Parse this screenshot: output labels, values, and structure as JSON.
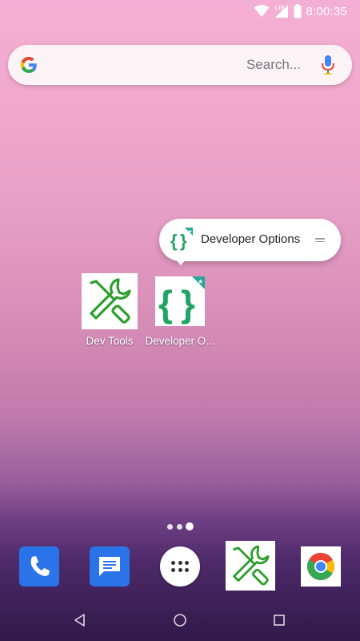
{
  "status_bar": {
    "time": "8:00:35",
    "network_label": "LTE",
    "icons": [
      "wifi-icon",
      "cellular-signal-icon",
      "battery-icon"
    ]
  },
  "search_bar": {
    "placeholder": "Search...",
    "logo": "google-g-logo",
    "mic_icon": "microphone-icon"
  },
  "shortcut_popup": {
    "label": "Developer Options",
    "icon": "developer-options-braces-icon",
    "handle_icon": "drag-handle-icon"
  },
  "desktop_apps": [
    {
      "label": "Dev Tools",
      "icon": "wrench-screwdriver-icon"
    },
    {
      "label": "Developer O...",
      "icon": "developer-options-braces-icon"
    }
  ],
  "page_indicator": {
    "pages": 3,
    "current": 3
  },
  "dock": [
    {
      "name": "Phone",
      "icon": "phone-icon"
    },
    {
      "name": "Messages",
      "icon": "message-icon"
    },
    {
      "name": "All apps",
      "icon": "app-drawer-icon"
    },
    {
      "name": "Dev Tools",
      "icon": "wrench-screwdriver-icon"
    },
    {
      "name": "Chrome",
      "icon": "chrome-icon"
    }
  ],
  "nav_bar": {
    "buttons": [
      "back-icon",
      "home-icon",
      "recents-icon"
    ]
  },
  "colors": {
    "accent_green": "#2e9e2e",
    "dev_options_green": "#1fa463",
    "dev_options_badge": "#26a69a",
    "dock_blue": "#2a73e8"
  }
}
